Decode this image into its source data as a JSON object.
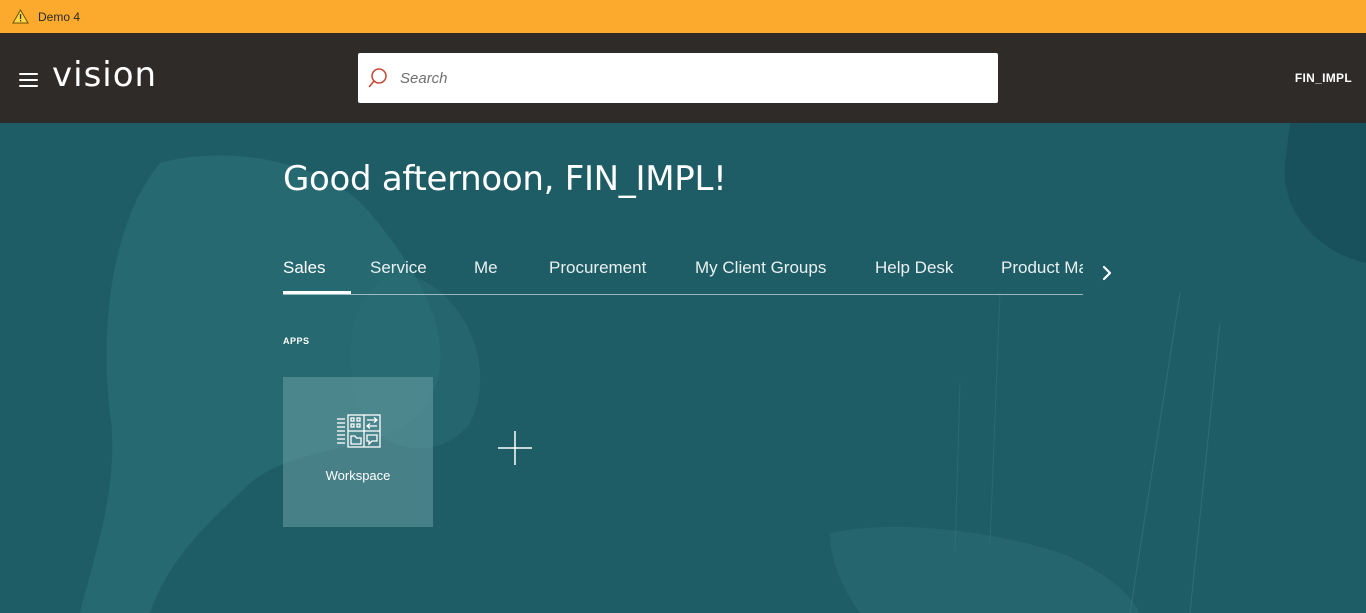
{
  "banner": {
    "label": "Demo 4",
    "icon": "warning-icon",
    "color": "#fbaa2e"
  },
  "header": {
    "menu_icon": "hamburger-menu-icon",
    "brand": "vision",
    "search": {
      "placeholder": "Search",
      "value": "",
      "icon": "search-icon"
    },
    "user": "FIN_IMPL",
    "background": "#2f2b28"
  },
  "main": {
    "background": "#1f5d66",
    "greeting": "Good afternoon, FIN_IMPL!",
    "tabs": [
      {
        "label": "Sales",
        "active": true
      },
      {
        "label": "Service"
      },
      {
        "label": "Me"
      },
      {
        "label": "Procurement"
      },
      {
        "label": "My Client Groups"
      },
      {
        "label": "Help Desk"
      },
      {
        "label": "Product Ma"
      }
    ],
    "tabs_next_icon": "chevron-right-icon",
    "section_label": "APPS",
    "apps": [
      {
        "label": "Workspace",
        "icon": "workspace-icon"
      }
    ],
    "add_icon": "plus-icon"
  }
}
